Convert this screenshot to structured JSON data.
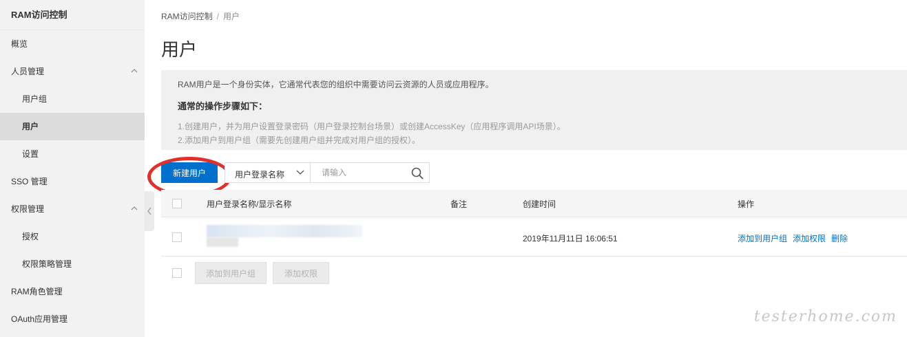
{
  "sidebar": {
    "title": "RAM访问控制",
    "items": [
      {
        "label": "概览"
      },
      {
        "label": "人员管理"
      },
      {
        "label": "用户组"
      },
      {
        "label": "用户"
      },
      {
        "label": "设置"
      },
      {
        "label": "SSO 管理"
      },
      {
        "label": "权限管理"
      },
      {
        "label": "授权"
      },
      {
        "label": "权限策略管理"
      },
      {
        "label": "RAM角色管理"
      },
      {
        "label": "OAuth应用管理"
      }
    ]
  },
  "breadcrumb": {
    "root": "RAM访问控制",
    "separator": "/",
    "current": "用户"
  },
  "page_title": "用户",
  "info": {
    "line1": "RAM用户是一个身份实体，它通常代表您的组织中需要访问云资源的人员或应用程序。",
    "heading": "通常的操作步骤如下：",
    "step1": "1.创建用户，并为用户设置登录密码（用户登录控制台场景）或创建AccessKey（应用程序调用API场景）。",
    "step2": "2.添加用户到用户组（需要先创建用户组并完成对用户组的授权）。"
  },
  "toolbar": {
    "create_label": "新建用户",
    "filter_selected": "用户登录名称",
    "search_placeholder": "请输入"
  },
  "table": {
    "columns": [
      "用户登录名称/显示名称",
      "备注",
      "创建时间",
      "操作"
    ],
    "rows": [
      {
        "created": "2019年11月11日 16:06:51",
        "actions": [
          "添加到用户组",
          "添加权限",
          "删除"
        ]
      }
    ]
  },
  "bulk": {
    "add_to_group": "添加到用户组",
    "add_permission": "添加权限"
  },
  "watermark": "testerhome.com",
  "colors": {
    "primary": "#0070cc",
    "highlight": "#e0302a"
  }
}
